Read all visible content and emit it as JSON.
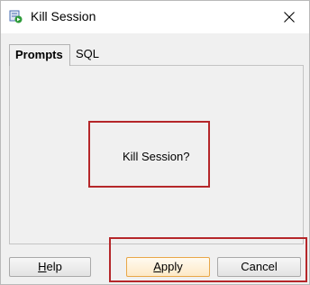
{
  "window": {
    "title": "Kill Session"
  },
  "tabs": [
    {
      "label": "Prompts",
      "active": true
    },
    {
      "label": "SQL",
      "active": false
    }
  ],
  "prompt": {
    "text": "Kill Session?"
  },
  "buttons": {
    "help": {
      "first": "H",
      "rest": "elp"
    },
    "apply": {
      "first": "A",
      "rest": "pply"
    },
    "cancel": {
      "label": "Cancel"
    }
  },
  "colors": {
    "annotation_border": "#b5272a",
    "default_button_border": "#e8a748"
  },
  "icons": {
    "app": "database-session-icon",
    "close": "close-icon"
  }
}
